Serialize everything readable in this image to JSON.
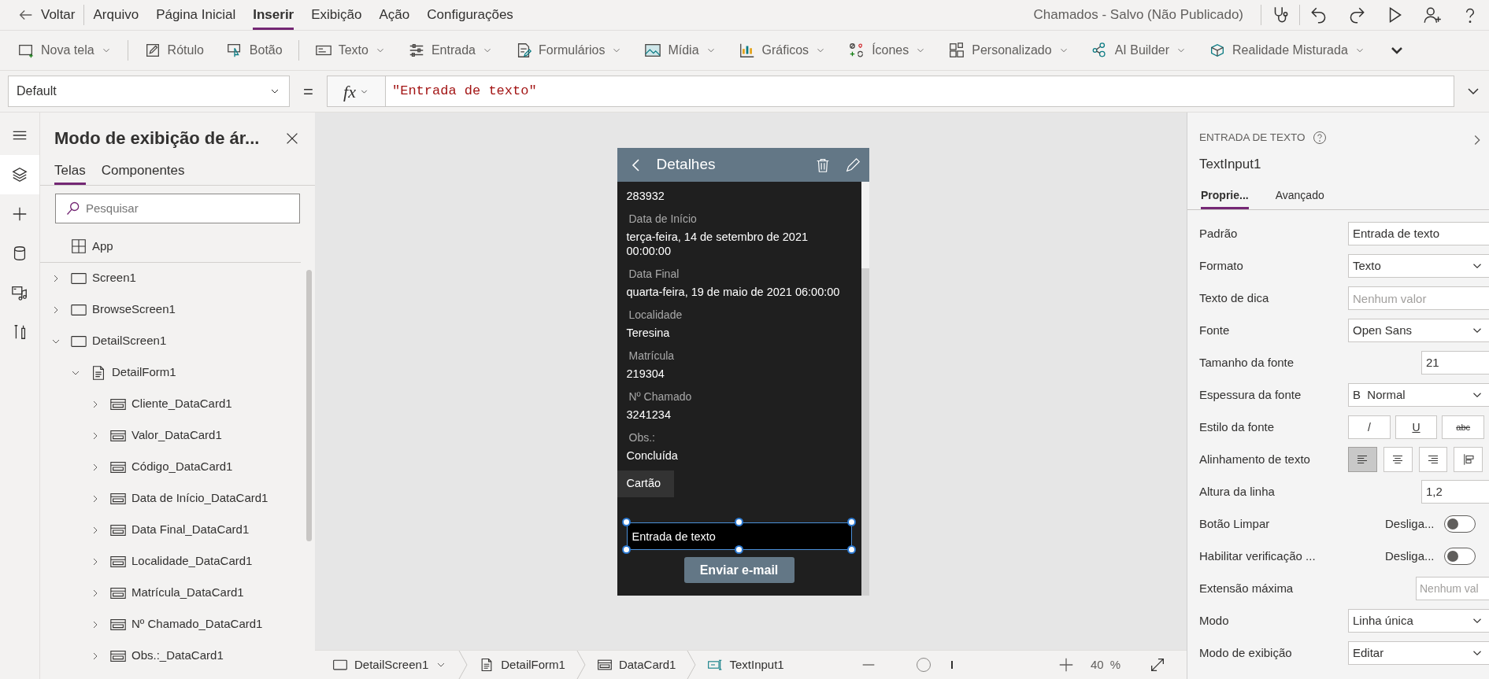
{
  "menu_bar": {
    "back": "Voltar",
    "items": [
      {
        "label": "Arquivo",
        "selected": false
      },
      {
        "label": "Página Inicial",
        "selected": false
      },
      {
        "label": "Inserir",
        "selected": true
      },
      {
        "label": "Exibição",
        "selected": false
      },
      {
        "label": "Ação",
        "selected": false
      },
      {
        "label": "Configurações",
        "selected": false
      }
    ],
    "title": "Chamados - Salvo (Não Publicado)"
  },
  "ribbon": [
    {
      "label": "Nova tela",
      "dropdown": true
    },
    {
      "label": "Rótulo",
      "dropdown": false
    },
    {
      "label": "Botão",
      "dropdown": false
    },
    {
      "label": "Texto",
      "dropdown": true
    },
    {
      "label": "Entrada",
      "dropdown": true
    },
    {
      "label": "Formulários",
      "dropdown": true
    },
    {
      "label": "Mídia",
      "dropdown": true
    },
    {
      "label": "Gráficos",
      "dropdown": true
    },
    {
      "label": "Ícones",
      "dropdown": true
    },
    {
      "label": "Personalizado",
      "dropdown": true
    },
    {
      "label": "AI Builder",
      "dropdown": true
    },
    {
      "label": "Realidade Misturada",
      "dropdown": true
    }
  ],
  "formula_bar": {
    "property": "Default",
    "equals": "=",
    "fx": "fx",
    "formula": "\"Entrada de texto\""
  },
  "rail": [
    {
      "selected": false
    },
    {
      "selected": true
    },
    {
      "selected": false
    },
    {
      "selected": false
    },
    {
      "selected": false
    },
    {
      "selected": false
    }
  ],
  "tree_panel": {
    "title": "Modo de exibição de ár...",
    "tabs": [
      {
        "label": "Telas",
        "selected": true
      },
      {
        "label": "Componentes",
        "selected": false
      }
    ],
    "search": {
      "placeholder": "Pesquisar"
    },
    "items": [
      {
        "label": "App",
        "kind": "app"
      },
      {
        "label": "Screen1",
        "kind": "screen",
        "expanded": false
      },
      {
        "label": "BrowseScreen1",
        "kind": "screen",
        "expanded": false
      },
      {
        "label": "DetailScreen1",
        "kind": "screen",
        "expanded": true,
        "children": [
          {
            "label": "DetailForm1",
            "kind": "form",
            "expanded": true,
            "children": [
              {
                "label": "Cliente_DataCard1",
                "kind": "card",
                "expanded": false
              },
              {
                "label": "Valor_DataCard1",
                "kind": "card",
                "expanded": false
              },
              {
                "label": "Código_DataCard1",
                "kind": "card",
                "expanded": false
              },
              {
                "label": "Data de Início_DataCard1",
                "kind": "card",
                "expanded": false
              },
              {
                "label": "Data Final_DataCard1",
                "kind": "card",
                "expanded": false
              },
              {
                "label": "Localidade_DataCard1",
                "kind": "card",
                "expanded": false
              },
              {
                "label": "Matrícula_DataCard1",
                "kind": "card",
                "expanded": false
              },
              {
                "label": "Nº Chamado_DataCard1",
                "kind": "card",
                "expanded": false
              },
              {
                "label": "Obs.:_DataCard1",
                "kind": "card",
                "expanded": false
              }
            ]
          }
        ]
      }
    ]
  },
  "phone": {
    "title": "Detalhes",
    "first_value": "283932",
    "fields": [
      {
        "label": "Data de Início",
        "value": "terça-feira, 14 de setembro de 2021 00:00:00"
      },
      {
        "label": "Data Final",
        "value": "quarta-feira, 19 de maio de 2021 06:00:00"
      },
      {
        "label": "Localidade",
        "value": "Teresina"
      },
      {
        "label": "Matrícula",
        "value": "219304"
      },
      {
        "label": "Nº Chamado",
        "value": "3241234"
      },
      {
        "label": "Obs.:",
        "value": "Concluída"
      }
    ],
    "tooltip": "Cartão",
    "text_input": {
      "value": "Entrada de texto",
      "selected": true
    },
    "button": "Enviar e-mail"
  },
  "breadcrumb": [
    {
      "label": "DetailScreen1",
      "kind": "screen",
      "dropdown": true
    },
    {
      "label": "DetailForm1",
      "kind": "form",
      "dropdown": false
    },
    {
      "label": "DataCard1",
      "kind": "card",
      "dropdown": false
    },
    {
      "label": "TextInput1",
      "kind": "input",
      "dropdown": false
    }
  ],
  "zoom": {
    "level": 0.23,
    "value": "40",
    "unit": "%"
  },
  "properties_panel": {
    "type": "ENTRADA DE TEXTO",
    "name": "TextInput1",
    "tabs": [
      {
        "label": "Proprie...",
        "selected": true
      },
      {
        "label": "Avançado",
        "selected": false
      }
    ],
    "rows": [
      {
        "kind": "text",
        "label": "Padrão",
        "value": "Entrada de texto"
      },
      {
        "kind": "dropdown",
        "label": "Formato",
        "value": "Texto"
      },
      {
        "kind": "placeholder",
        "label": "Texto de dica",
        "placeholder": "Nenhum valor"
      },
      {
        "kind": "dropdown",
        "label": "Fonte",
        "value": "Open Sans"
      },
      {
        "kind": "number",
        "label": "Tamanho da fonte",
        "value": "21"
      },
      {
        "kind": "weight",
        "label": "Espessura da fonte",
        "glyph": "B",
        "value": "Normal"
      },
      {
        "kind": "style",
        "label": "Estilo da fonte",
        "buttons": [
          "/",
          "U",
          "abc"
        ]
      },
      {
        "kind": "align",
        "label": "Alinhamento de texto",
        "buttons": [
          {
            "selected": true
          },
          {
            "selected": false
          },
          {
            "selected": false
          },
          {
            "selected": false
          }
        ]
      },
      {
        "kind": "number",
        "label": "Altura da linha",
        "value": "1,2"
      },
      {
        "kind": "toggle",
        "label": "Botão Limpar",
        "state": "Desliga...",
        "on": false
      },
      {
        "kind": "toggle",
        "label": "Habilitar verificação ...",
        "state": "Desliga...",
        "on": false
      },
      {
        "kind": "number_placeholder",
        "label": "Extensão máxima",
        "placeholder": "Nenhum val"
      },
      {
        "kind": "dropdown",
        "label": "Modo",
        "value": "Linha única"
      },
      {
        "kind": "dropdown",
        "label": "Modo de exibição",
        "value": "Editar"
      }
    ]
  }
}
